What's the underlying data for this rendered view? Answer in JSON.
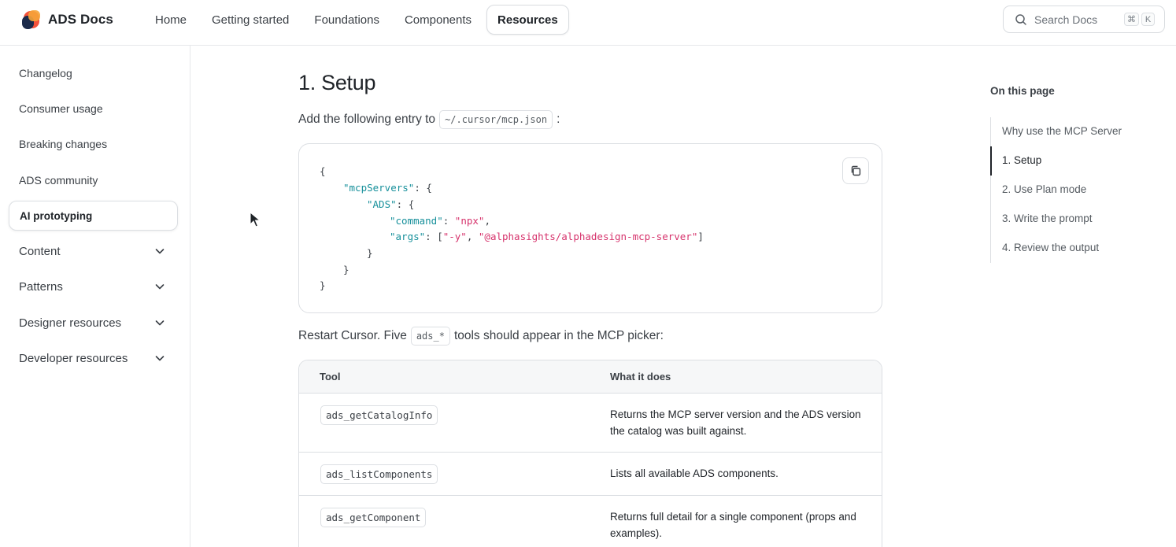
{
  "header": {
    "brand": "ADS Docs",
    "logo_icon": "ads-logo",
    "nav": [
      {
        "label": "Home"
      },
      {
        "label": "Getting started"
      },
      {
        "label": "Foundations"
      },
      {
        "label": "Components"
      },
      {
        "label": "Resources",
        "active": true
      }
    ],
    "search": {
      "placeholder": "Search Docs",
      "shortcut_keys": [
        "⌘",
        "K"
      ]
    }
  },
  "sidebar": {
    "items": [
      {
        "label": "Changelog"
      },
      {
        "label": "Consumer usage"
      },
      {
        "label": "Breaking changes"
      },
      {
        "label": "ADS community"
      },
      {
        "label": "AI prototyping",
        "active": true
      },
      {
        "label": "Content",
        "expandable": true
      },
      {
        "label": "Patterns",
        "expandable": true
      },
      {
        "label": "Designer resources",
        "expandable": true
      },
      {
        "label": "Developer resources",
        "expandable": true
      }
    ]
  },
  "main": {
    "heading": "1. Setup",
    "intro_prefix": "Add the following entry to",
    "intro_code": "~/.cursor/mcp.json",
    "intro_suffix": ":",
    "code": {
      "l1": "{",
      "l2_key": "\"mcpServers\"",
      "l2_rest": ": {",
      "l3_key": "\"ADS\"",
      "l3_rest": ": {",
      "l4_key": "\"command\"",
      "l4_sep": ": ",
      "l4_val": "\"npx\"",
      "l4_end": ",",
      "l5_key": "\"args\"",
      "l5_sep": ": [",
      "l5_val1": "\"-y\"",
      "l5_comma": ", ",
      "l5_val2": "\"@alphasights/alphadesign-mcp-server\"",
      "l5_end": "]",
      "l6": "}",
      "l7": "}",
      "l8": "}"
    },
    "restart_prefix": "Restart Cursor. Five",
    "restart_code": "ads_*",
    "restart_suffix": "tools should appear in the MCP picker:",
    "table": {
      "headers": [
        "Tool",
        "What it does"
      ],
      "rows": [
        {
          "tool": "ads_getCatalogInfo",
          "desc": "Returns the MCP server version and the ADS version the catalog was built against."
        },
        {
          "tool": "ads_listComponents",
          "desc": "Lists all available ADS components."
        },
        {
          "tool": "ads_getComponent",
          "desc": "Returns full detail for a single component (props and examples)."
        }
      ]
    }
  },
  "toc": {
    "title": "On this page",
    "items": [
      {
        "label": "Why use the MCP Server"
      },
      {
        "label": "1. Setup",
        "active": true
      },
      {
        "label": "2. Use Plan mode"
      },
      {
        "label": "3. Write the prompt"
      },
      {
        "label": "4. Review the output"
      }
    ]
  },
  "colors": {
    "accent_key": "#17909b",
    "accent_string": "#d6336c",
    "text": "#1f2328"
  }
}
